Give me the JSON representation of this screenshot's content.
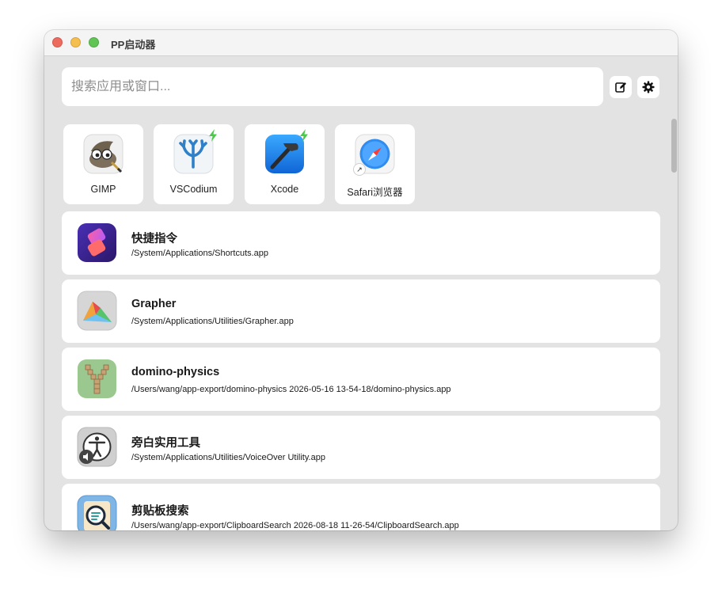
{
  "window": {
    "title": "PP启动器"
  },
  "search": {
    "placeholder": "搜索应用或窗口..."
  },
  "toolbar": {
    "edit_icon": "edit-icon",
    "settings_icon": "gear-icon"
  },
  "favorites": [
    {
      "label": "GIMP",
      "icon": "gimp-app-icon"
    },
    {
      "label": "VSCodium",
      "icon": "vscodium-app-icon",
      "badge": "lightning"
    },
    {
      "label": "Xcode",
      "icon": "xcode-app-icon",
      "badge": "lightning"
    },
    {
      "label": "Safari浏览器",
      "icon": "safari-app-icon",
      "alias": "↗"
    }
  ],
  "results": [
    {
      "name": "快捷指令",
      "path": "/System/Applications/Shortcuts.app",
      "icon": "shortcuts-app-icon"
    },
    {
      "name": "Grapher",
      "path": "/System/Applications/Utilities/Grapher.app",
      "icon": "grapher-app-icon"
    },
    {
      "name": "domino-physics",
      "path": "/Users/wang/app-export/domino-physics 2026-05-16 13-54-18/domino-physics.app",
      "icon": "domino-physics-app-icon"
    },
    {
      "name": "旁白实用工具",
      "path": "/System/Applications/Utilities/VoiceOver Utility.app",
      "icon": "voiceover-utility-app-icon"
    },
    {
      "name": "剪贴板搜索",
      "path": "/Users/wang/app-export/ClipboardSearch 2026-08-18 11-26-54/ClipboardSearch.app",
      "icon": "clipboard-search-app-icon"
    }
  ],
  "colors": {
    "window_bg": "#e3e3e3",
    "card_bg": "#ffffff",
    "badge_green": "#4cc94a"
  }
}
